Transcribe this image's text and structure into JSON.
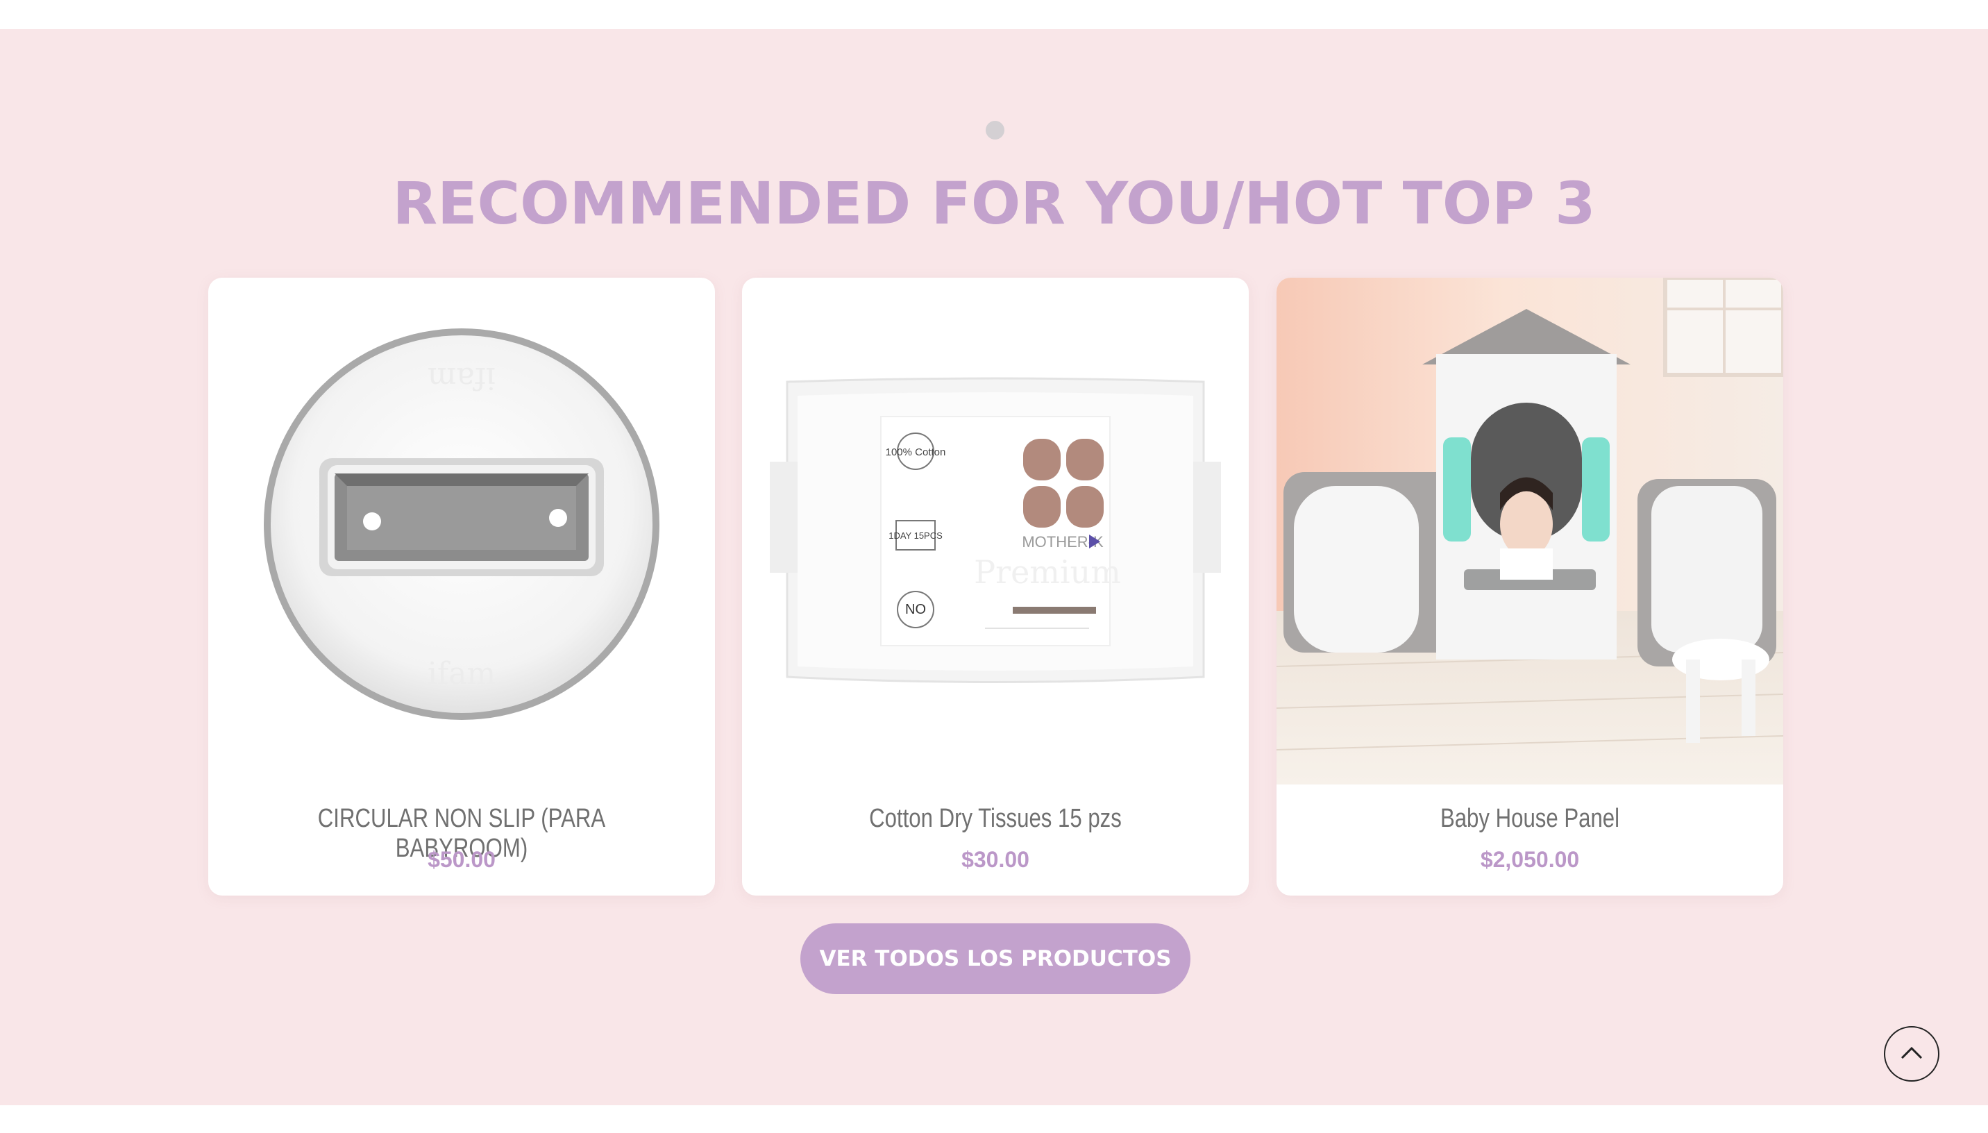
{
  "section": {
    "heading": "RECOMMENDED FOR YOU/HOT TOP 3",
    "cta_label": "VER TODOS LOS PRODUCTOS"
  },
  "products": [
    {
      "title": "CIRCULAR NON SLIP (PARA BABYROOM)",
      "price": "$50.00"
    },
    {
      "title": "Cotton Dry Tissues 15 pzs",
      "price": "$30.00"
    },
    {
      "title": "Baby House Panel",
      "price": "$2,050.00"
    }
  ],
  "product_image_text": {
    "tissue_cotton": "100% Cotton",
    "tissue_count": "1DAY 15PCS",
    "tissue_no": "NO",
    "tissue_brand": "MOTHER-K"
  },
  "colors": {
    "accent": "#c3a2cd",
    "background": "#f9e6e8",
    "price": "#bb97c8"
  },
  "icons": {
    "back_to_top": "chevron-up-icon",
    "carousel_dot": "carousel-dot"
  }
}
